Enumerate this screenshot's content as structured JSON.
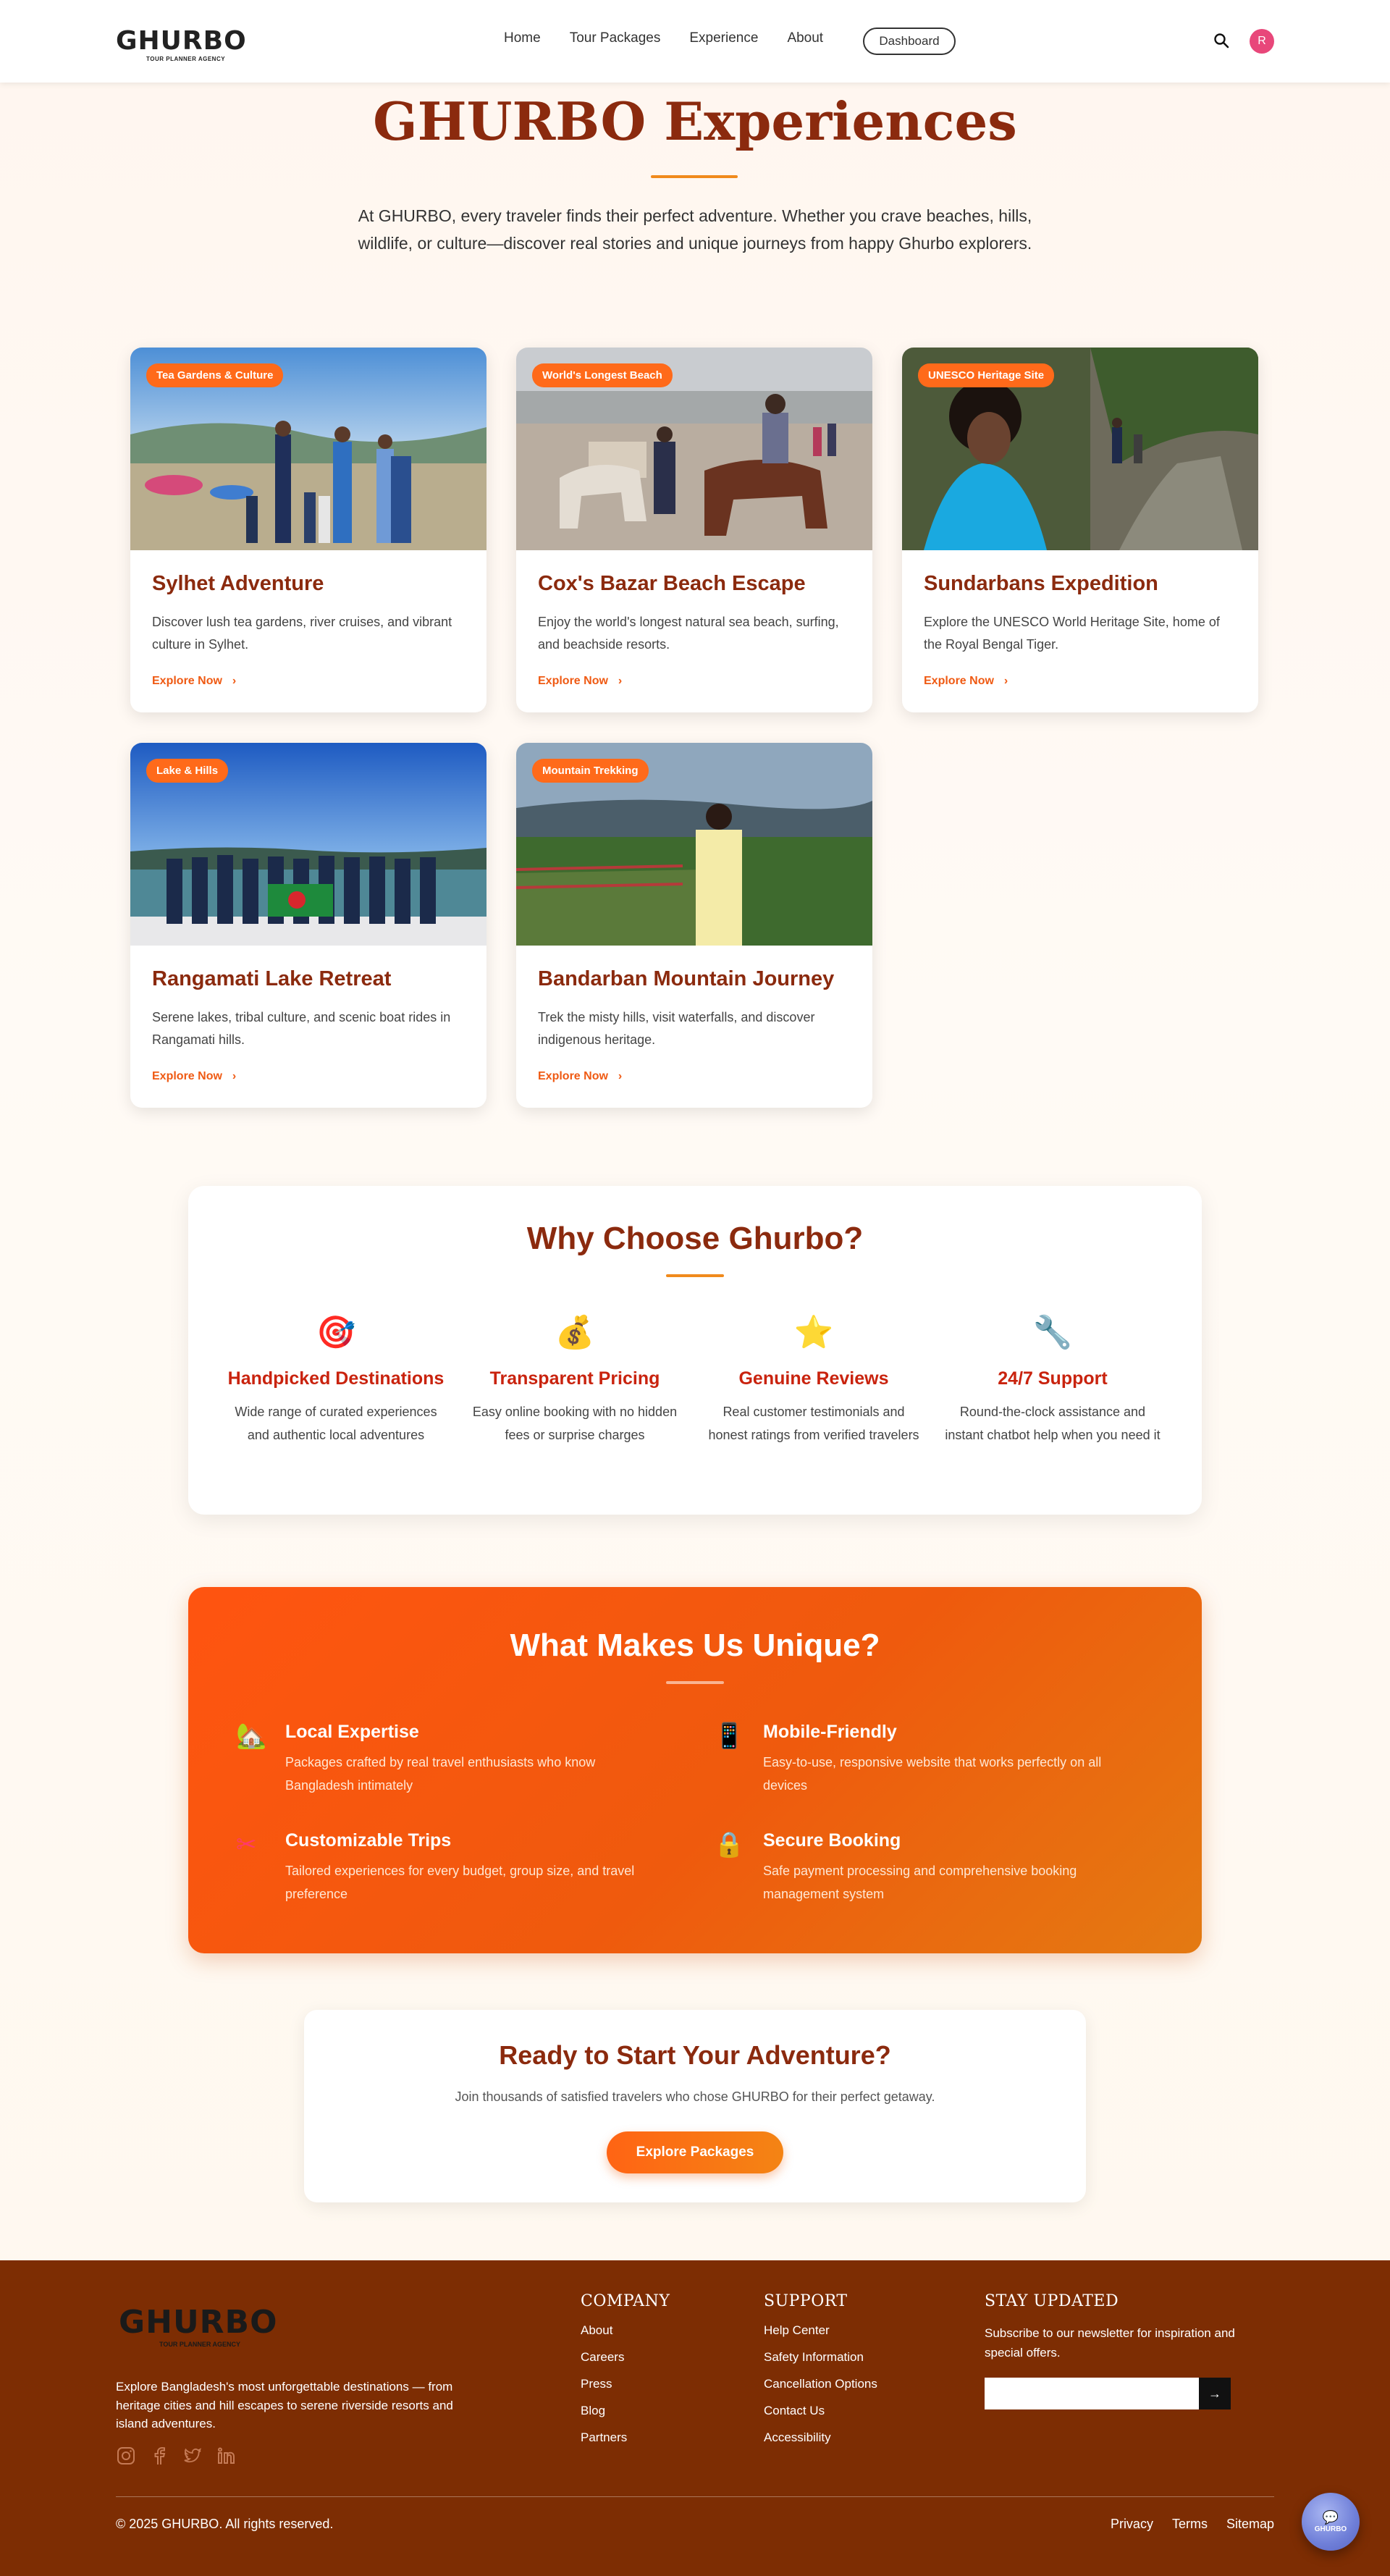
{
  "brand": {
    "logo_text": "GHURBO",
    "logo_subtitle": "TOUR PLANNER AGENCY",
    "accent": "#ef5a13",
    "heading_color": "#8b2a0e",
    "footer_bg": "#7d2d03"
  },
  "nav": {
    "links": [
      "Home",
      "Tour Packages",
      "Experience",
      "About"
    ],
    "dashboard": "Dashboard",
    "search_icon": "search-icon",
    "avatar_initial": "R"
  },
  "hero": {
    "title": "GHURBO Experiences",
    "description": "At GHURBO, every traveler finds their perfect adventure. Whether you crave beaches, hills, wildlife, or culture—discover real stories and unique journeys from happy Ghurbo explorers."
  },
  "cards": [
    {
      "tag": "Tea Gardens & Culture",
      "title": "Sylhet Adventure",
      "desc": "Discover lush tea gardens, river cruises, and vibrant culture in Sylhet.",
      "link": "Explore Now"
    },
    {
      "tag": "World's Longest Beach",
      "title": "Cox's Bazar Beach Escape",
      "desc": "Enjoy the world's longest natural sea beach, surfing, and beachside resorts.",
      "link": "Explore Now"
    },
    {
      "tag": "UNESCO Heritage Site",
      "title": "Sundarbans Expedition",
      "desc": "Explore the UNESCO World Heritage Site, home of the Royal Bengal Tiger.",
      "link": "Explore Now"
    },
    {
      "tag": "Lake & Hills",
      "title": "Rangamati Lake Retreat",
      "desc": "Serene lakes, tribal culture, and scenic boat rides in Rangamati hills.",
      "link": "Explore Now"
    },
    {
      "tag": "Mountain Trekking",
      "title": "Bandarban Mountain Journey",
      "desc": "Trek the misty hills, visit waterfalls, and discover indigenous heritage.",
      "link": "Explore Now"
    }
  ],
  "why": {
    "title": "Why Choose Ghurbo?",
    "items": [
      {
        "icon": "target-icon",
        "glyph": "🎯",
        "title": "Handpicked Destinations",
        "desc": "Wide range of curated experiences and authentic local adventures"
      },
      {
        "icon": "money-bag-icon",
        "glyph": "💰",
        "title": "Transparent Pricing",
        "desc": "Easy online booking with no hidden fees or surprise charges"
      },
      {
        "icon": "star-icon",
        "glyph": "⭐",
        "title": "Genuine Reviews",
        "desc": "Real customer testimonials and honest ratings from verified travelers"
      },
      {
        "icon": "wrench-icon",
        "glyph": "🔧",
        "title": "24/7 Support",
        "desc": "Round-the-clock assistance and instant chatbot help when you need it"
      }
    ]
  },
  "unique": {
    "title": "What Makes Us Unique?",
    "items": [
      {
        "icon": "house-icon",
        "glyph": "🏡",
        "title": "Local Expertise",
        "desc": "Packages crafted by real travel enthusiasts who know Bangladesh intimately"
      },
      {
        "icon": "mobile-icon",
        "glyph": "📱",
        "title": "Mobile-Friendly",
        "desc": "Easy-to-use, responsive website that works perfectly on all devices"
      },
      {
        "icon": "tools-icon",
        "glyph": "✂",
        "title": "Customizable Trips",
        "desc": "Tailored experiences for every budget, group size, and travel preference"
      },
      {
        "icon": "lock-icon",
        "glyph": "🔒",
        "title": "Secure Booking",
        "desc": "Safe payment processing and comprehensive booking management system"
      }
    ]
  },
  "cta": {
    "title": "Ready to Start Your Adventure?",
    "desc": "Join thousands of satisfied travelers who chose GHURBO for their perfect getaway.",
    "button": "Explore Packages"
  },
  "footer": {
    "about": "Explore Bangladesh's most unforgettable destinations — from heritage cities and hill escapes to serene riverside resorts and island adventures.",
    "social": [
      "instagram-icon",
      "facebook-icon",
      "twitter-icon",
      "linkedin-icon"
    ],
    "company": {
      "title": "COMPANY",
      "links": [
        "About",
        "Careers",
        "Press",
        "Blog",
        "Partners"
      ]
    },
    "support": {
      "title": "SUPPORT",
      "links": [
        "Help Center",
        "Safety Information",
        "Cancellation Options",
        "Contact Us",
        "Accessibility"
      ]
    },
    "newsletter": {
      "title": "STAY UPDATED",
      "desc": "Subscribe to our newsletter for inspiration and special offers.",
      "placeholder": "",
      "submit_glyph": "→"
    },
    "copyright": "© 2025 GHURBO. All rights reserved.",
    "legal": [
      "Privacy",
      "Terms",
      "Sitemap"
    ]
  },
  "chatbot": {
    "label": "GHURBO"
  }
}
